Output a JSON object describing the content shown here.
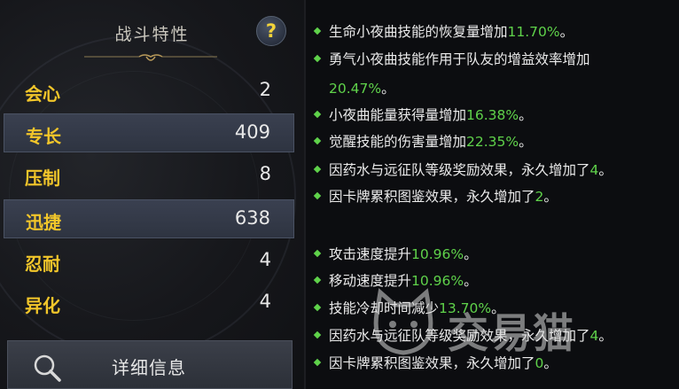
{
  "panel": {
    "title": "战斗特性",
    "help_glyph": "?"
  },
  "stats": [
    {
      "name": "会心",
      "value": "2",
      "highlighted": false
    },
    {
      "name": "专长",
      "value": "409",
      "highlighted": true
    },
    {
      "name": "压制",
      "value": "8",
      "highlighted": false
    },
    {
      "name": "迅捷",
      "value": "638",
      "highlighted": true
    },
    {
      "name": "忍耐",
      "value": "4",
      "highlighted": false
    },
    {
      "name": "异化",
      "value": "4",
      "highlighted": false
    }
  ],
  "detail_button": {
    "label": "详细信息",
    "icon": "search-icon"
  },
  "effects": [
    {
      "pre": "生命小夜曲技能的恢复量增加",
      "val": "11.70%",
      "post": "。"
    },
    {
      "pre": "勇气小夜曲技能作用于队友的增益效率增加",
      "val": "",
      "post": ""
    },
    {
      "pre": "",
      "val": "20.47%",
      "post": "。"
    },
    {
      "pre": "小夜曲能量获得量增加",
      "val": "16.38%",
      "post": "。"
    },
    {
      "pre": "觉醒技能的伤害量增加",
      "val": "22.35%",
      "post": "。"
    },
    {
      "pre": "因药水与远征队等级奖励效果，永久增加了",
      "val": "4",
      "post": "。"
    },
    {
      "pre": "因卡牌累积图鉴效果，永久增加了",
      "val": "2",
      "post": "。"
    },
    {
      "pre": "攻击速度提升",
      "val": "10.96%",
      "post": "。"
    },
    {
      "pre": "移动速度提升",
      "val": "10.96%",
      "post": "。"
    },
    {
      "pre": "技能冷却时间减少",
      "val": "13.70%",
      "post": "。"
    },
    {
      "pre": "因药水与远征队等级奖励效果，永久增加了",
      "val": "4",
      "post": "。"
    },
    {
      "pre": "因卡牌累积图鉴效果，永久增加了",
      "val": "0",
      "post": "。"
    }
  ],
  "watermark": {
    "text": "交易猫"
  },
  "colors": {
    "accent_gold": "#f2c62a",
    "value_green": "#5fd24a",
    "help_yellow": "#f2d33a"
  }
}
